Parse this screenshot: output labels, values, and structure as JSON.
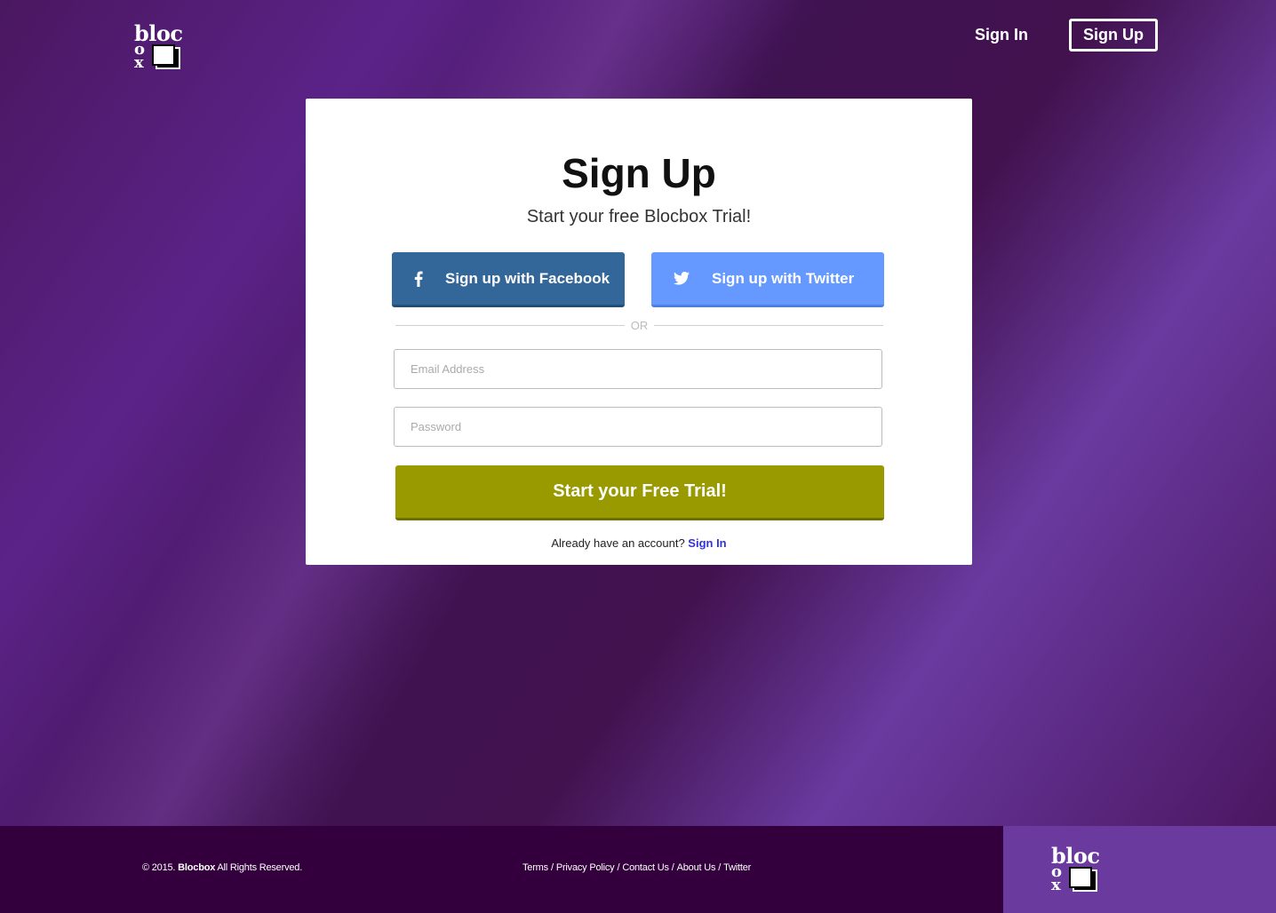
{
  "brand": {
    "logo_line1": "bloc",
    "logo_o": "o",
    "logo_x": "x",
    "accent": "#5b2388",
    "footer_dark": "#33003d",
    "footer_accent": "#6a3a9f"
  },
  "nav": {
    "signin": "Sign In",
    "signup": "Sign Up"
  },
  "card": {
    "title": "Sign Up",
    "subtitle": "Start your free Blocbox Trial!",
    "facebook_label": "Sign up with Facebook",
    "facebook_color": "#336699",
    "twitter_label": "Sign up with Twitter",
    "twitter_color": "#6699ff",
    "or": "OR",
    "email_placeholder": "Email Address",
    "password_placeholder": "Password",
    "cta_label": "Start your Free Trial!",
    "cta_color": "#999900",
    "already_text": "Already have an account?",
    "already_link": "Sign In"
  },
  "footer": {
    "copyright_prefix": "© 2015.",
    "copyright_brand": "Blocbox",
    "copyright_suffix": "All Rights Reserved.",
    "links": [
      "Terms",
      "Privacy Policy",
      "Contact Us",
      "About Us",
      "Twitter"
    ]
  }
}
